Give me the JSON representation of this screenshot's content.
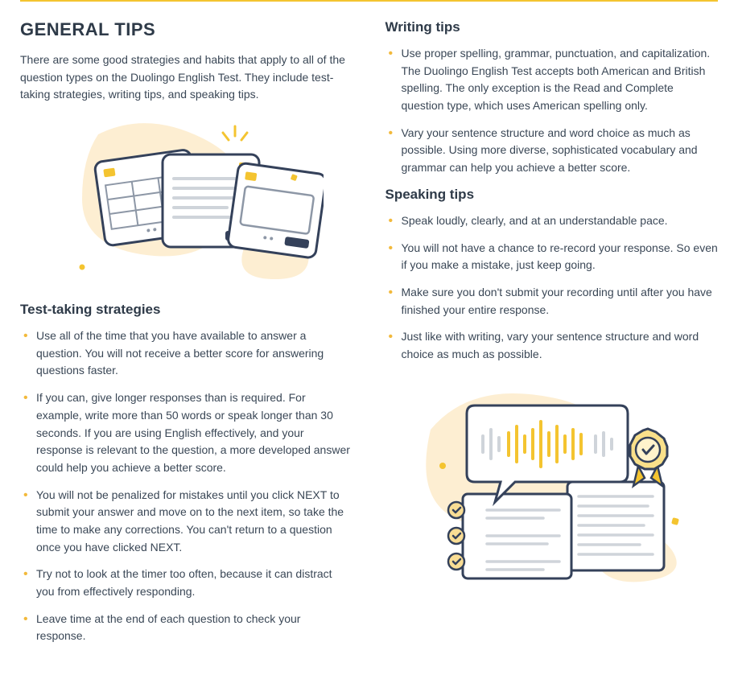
{
  "main_title": "GENERAL TIPS",
  "intro": "There are some good strategies and habits that apply to all of the question types on the Duolingo English Test. They include test-taking strategies, writing tips, and speaking tips.",
  "sections": {
    "test_taking": {
      "title": "Test-taking strategies",
      "items": [
        "Use all of the time that you have available to answer a question. You will not receive a better score for answering questions faster.",
        "If you can, give longer responses than is required. For example, write more than 50 words or speak longer than 30 seconds. If you are using English effectively, and your response is relevant to the question, a more developed answer could help you achieve a better score.",
        "You will not be penalized for mistakes until you click NEXT to submit your answer and move on to the next item, so take the time to make any corrections.  You can't return to a question once you have clicked NEXT.",
        "Try not to look at the timer too often, because it can distract you from effectively responding.",
        "Leave time at the end of each question to check your response."
      ]
    },
    "writing": {
      "title": "Writing tips",
      "items": [
        "Use proper spelling, grammar, punctuation, and capitalization. The Duolingo English Test accepts both American and British spelling. The only exception is the Read and Complete question type, which uses American spelling only.",
        "Vary your sentence structure and word choice as much as possible. Using more diverse, sophisticated vocabulary and grammar can help you achieve a better score."
      ]
    },
    "speaking": {
      "title": "Speaking tips",
      "items": [
        "Speak loudly, clearly, and at an understandable pace.",
        "You will not have a chance to re-record your response. So even if you make a mistake, just keep going.",
        "Make sure you don't submit your recording until after you have finished your entire response.",
        "Just like with writing, vary your sentence structure and word choice as much as possible."
      ]
    }
  }
}
